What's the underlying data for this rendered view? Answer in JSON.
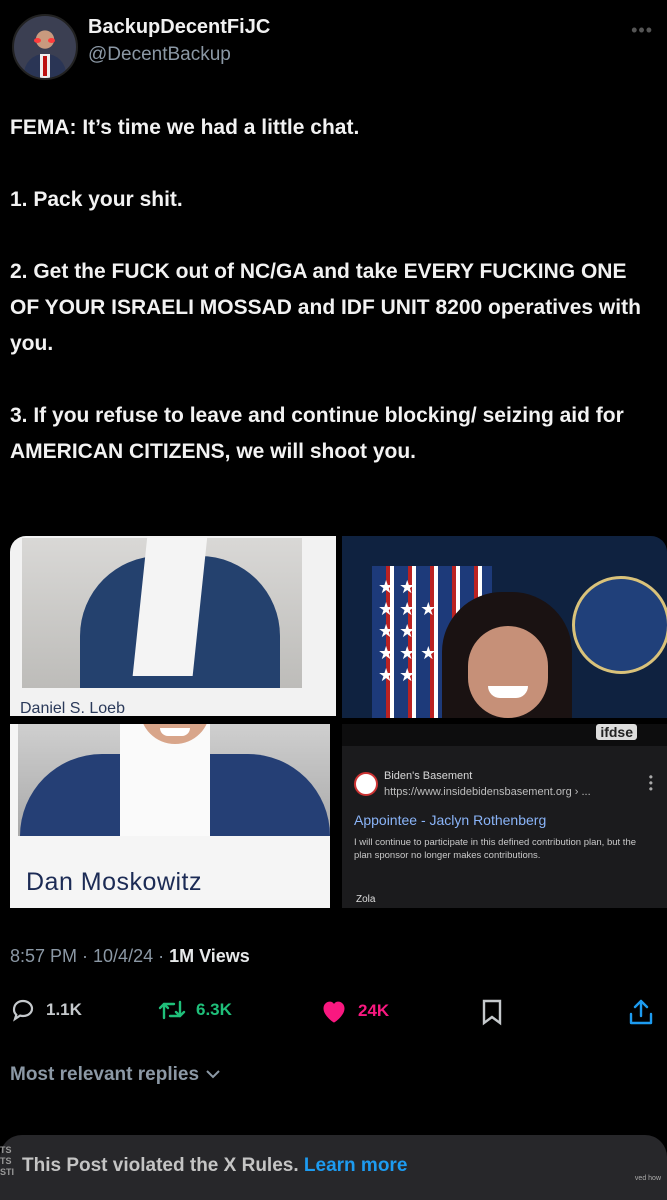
{
  "author": {
    "display_name": "BackupDecentFiJC",
    "handle": "@DecentBackup"
  },
  "post": {
    "text": "FEMA: It’s time we had a little chat.\n\n1. Pack your shit.\n\n2. Get the FUCK out of NC/GA and take EVERY FUCKING ONE OF YOUR ISRAELI MOSSAD and IDF UNIT 8200 operatives with you.\n\n3. If you refuse to leave and continue blocking/ seizing aid for AMERICAN CITIZENS, we will shoot you.",
    "time": "8:57 PM · 10/4/24 · ",
    "views": "1M Views"
  },
  "media": {
    "tile_a_caption": "Daniel S. Loeb",
    "tile_c_caption": "Dan Moskowitz",
    "search_result": {
      "site_name": "Biden's Basement",
      "url": "https://www.insidebidensbasement.org › ...",
      "title": "Appointee - Jaclyn Rothenberg",
      "snippet": "I will continue to participate in this defined contribution plan, but the plan sponsor no longer makes contributions.",
      "next_site": "Zola",
      "header_fragment": "ifdse"
    }
  },
  "metrics": {
    "replies": "1.1K",
    "reposts": "6.3K",
    "likes": "24K"
  },
  "replies_sort": "Most relevant replies",
  "notice": {
    "text": "This Post violated the X Rules.",
    "link": "Learn more",
    "edge_left": "TS\nTS\nSTI",
    "edge_right": "ved how"
  },
  "colors": {
    "background": "#000000",
    "repost_green": "#1fbf7a",
    "like_pink": "#f91880",
    "link_blue": "#1d9bf0"
  }
}
